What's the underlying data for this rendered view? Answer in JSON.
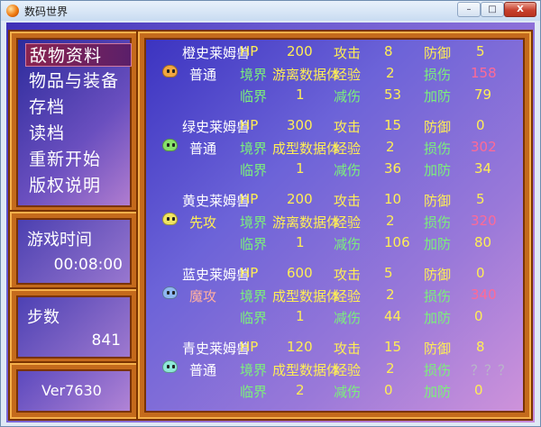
{
  "window": {
    "title": "数码世界",
    "min_glyph": "–",
    "max_glyph": "□",
    "close_glyph": "X"
  },
  "menu": {
    "items": [
      {
        "label": "敌物资料",
        "selected": true
      },
      {
        "label": "物品与装备"
      },
      {
        "label": "存档"
      },
      {
        "label": "读档"
      },
      {
        "label": "重新开始"
      },
      {
        "label": "版权说明"
      }
    ]
  },
  "time": {
    "label": "游戏时间",
    "value": "00:08:00"
  },
  "steps": {
    "label": "步数",
    "value": "841"
  },
  "version": "Ver7630",
  "labels": {
    "hp": "HP",
    "attack": "攻击",
    "defense": "防御",
    "realm": "境界",
    "exp": "经验",
    "damage": "损伤",
    "critical": "临界",
    "reduce": "减伤",
    "add_def": "加防"
  },
  "monsters": [
    {
      "name": "橙史莱姆兽",
      "color": "#f2a640",
      "hp": "200",
      "attack": "8",
      "defense": "5",
      "special": "普通",
      "special_color": "#ffffff",
      "realm": "游离数据体",
      "exp": "2",
      "damage": "158",
      "critical": "1",
      "reduce": "53",
      "add_def": "79"
    },
    {
      "name": "绿史莱姆兽",
      "color": "#86e06a",
      "hp": "300",
      "attack": "15",
      "defense": "0",
      "special": "普通",
      "special_color": "#ffffff",
      "realm": "成型数据体",
      "exp": "2",
      "damage": "302",
      "critical": "1",
      "reduce": "36",
      "add_def": "34"
    },
    {
      "name": "黄史莱姆兽",
      "color": "#f1e460",
      "hp": "200",
      "attack": "10",
      "defense": "5",
      "special": "先攻",
      "special_color": "#ffee55",
      "realm": "游离数据体",
      "exp": "2",
      "damage": "320",
      "critical": "1",
      "reduce": "106",
      "add_def": "80"
    },
    {
      "name": "蓝史莱姆兽",
      "color": "#8eb6f0",
      "hp": "600",
      "attack": "5",
      "defense": "0",
      "special": "魔攻",
      "special_color": "#ffb0a0",
      "realm": "成型数据体",
      "exp": "2",
      "damage": "340",
      "critical": "1",
      "reduce": "44",
      "add_def": "0"
    },
    {
      "name": "青史莱姆兽",
      "color": "#8ee8d8",
      "hp": "120",
      "attack": "15",
      "defense": "8",
      "special": "普通",
      "special_color": "#ffffff",
      "realm": "成型数据体",
      "exp": "2",
      "damage": "？？？",
      "critical": "2",
      "reduce": "0",
      "add_def": "0"
    }
  ]
}
